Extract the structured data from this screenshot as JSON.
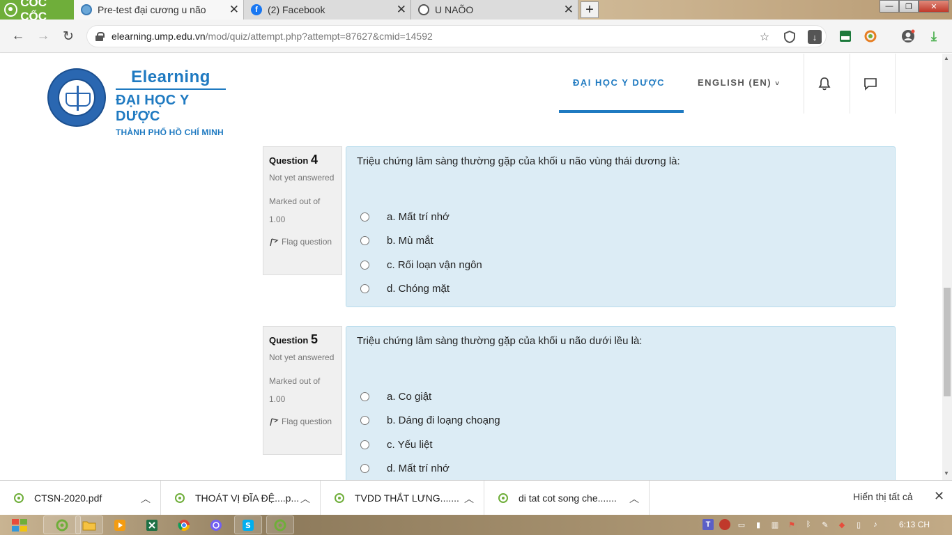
{
  "browser": {
    "brand": "CỐC CỐC",
    "tabs": [
      {
        "title": "Pre-test đại cương u não",
        "active": true
      },
      {
        "title": "(2) Facebook",
        "active": false
      },
      {
        "title": "U NAÕO",
        "active": false
      }
    ],
    "url_host": "elearning.ump.edu.vn",
    "url_path": "/mod/quiz/attempt.php?attempt=87627&cmid=14592"
  },
  "header": {
    "brand_title": "Elearning",
    "brand_line1": "ĐẠI HỌC Y DƯỢC",
    "brand_line2": "THÀNH PHỐ HỒ CHÍ MINH",
    "seal_text_outer": "ĐẠI HỌC Y DƯỢC THÀNH PHỐ HỒ CHÍ MINH",
    "seal_country": "VIỆT NAM",
    "seal_year": "1947",
    "nav_primary": "ĐẠI HỌC Y DƯỢC",
    "nav_language": "ENGLISH (EN)"
  },
  "questions": [
    {
      "label": "Question",
      "number": "4",
      "state": "Not yet answered",
      "grade_label": "Marked out of",
      "grade": "1.00",
      "flag": "Flag question",
      "text": "Triệu chứng lâm sàng thường gặp của khối u não vùng thái dương là:",
      "answers": [
        "a. Mất trí nhớ",
        "b. Mù mắt",
        "c. Rối loạn vận ngôn",
        "d. Chóng mặt"
      ]
    },
    {
      "label": "Question",
      "number": "5",
      "state": "Not yet answered",
      "grade_label": "Marked out of",
      "grade": "1.00",
      "flag": "Flag question",
      "text": "Triệu chứng lâm sàng thường gặp của khối u não dưới lều là:",
      "answers": [
        "a. Co giật",
        "b. Dáng đi loạng choạng",
        "c. Yếu liệt",
        "d. Mất trí nhớ"
      ]
    }
  ],
  "downloads": {
    "items": [
      "CTSN-2020.pdf",
      "THOÁT VỊ ĐĨA ĐỆ....p...",
      "TVDD THẮT LƯNG.......",
      "di tat cot song che......."
    ],
    "show_all": "Hiển thị tất cả"
  },
  "taskbar": {
    "clock": "6:13 CH"
  },
  "colors": {
    "accent": "#1f7ac1",
    "question_bg": "#dcecf5",
    "info_bg": "#f0f0f0",
    "brand_green": "#6fae3a"
  }
}
